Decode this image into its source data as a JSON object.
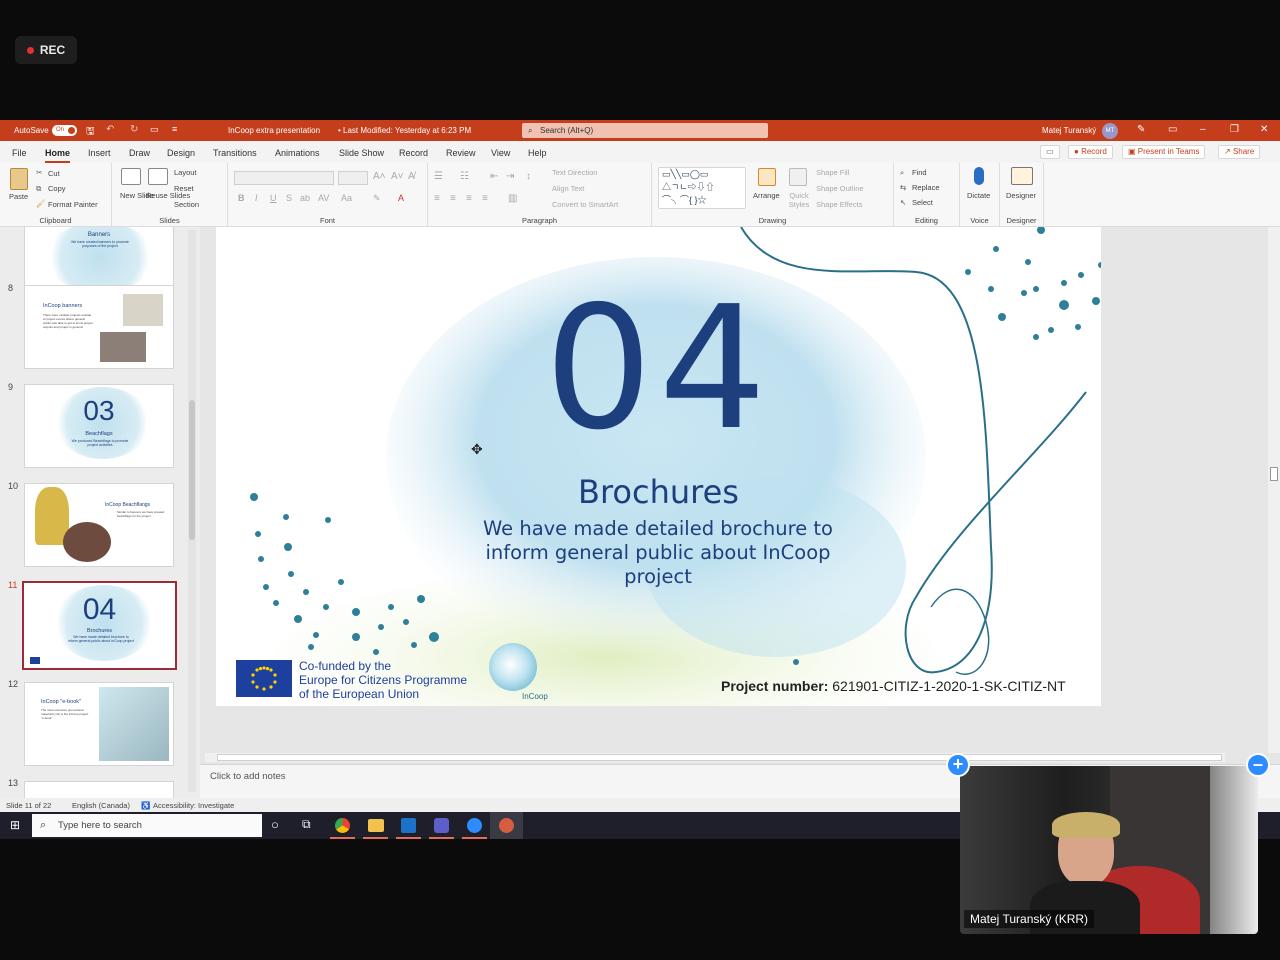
{
  "recording": {
    "label": "REC"
  },
  "titlebar": {
    "autosave_label": "AutoSave",
    "autosave_state": "On",
    "doc_title": "InCoop extra presentation",
    "last_modified": "• Last Modified: Yesterday at 6:23 PM",
    "search_placeholder": "Search (Alt+Q)",
    "user_name": "Matej Turanský",
    "user_initials": "MT"
  },
  "menu": {
    "items": [
      "File",
      "Home",
      "Insert",
      "Draw",
      "Design",
      "Transitions",
      "Animations",
      "Slide Show",
      "Record",
      "Review",
      "View",
      "Help"
    ],
    "active": "Home",
    "record_btn": "Record",
    "present_btn": "Present in Teams",
    "share_btn": "Share"
  },
  "ribbon": {
    "clipboard": {
      "label": "Clipboard",
      "paste": "Paste",
      "cut": "Cut",
      "copy": "Copy",
      "format_painter": "Format Painter"
    },
    "slides": {
      "label": "Slides",
      "new_slide": "New Slide",
      "reuse_slides": "Reuse Slides",
      "layout": "Layout",
      "reset": "Reset",
      "section": "Section"
    },
    "font": {
      "label": "Font"
    },
    "paragraph": {
      "label": "Paragraph",
      "text_direction": "Text Direction",
      "align_text": "Align Text",
      "convert_smartart": "Convert to SmartArt"
    },
    "drawing": {
      "label": "Drawing",
      "arrange": "Arrange",
      "quick_styles": "Quick Styles",
      "shape_fill": "Shape Fill",
      "shape_outline": "Shape Outline",
      "shape_effects": "Shape Effects"
    },
    "editing": {
      "label": "Editing",
      "find": "Find",
      "replace": "Replace",
      "select": "Select"
    },
    "voice": {
      "label": "Voice",
      "dictate": "Dictate"
    },
    "designer": {
      "label": "Designer",
      "designer": "Designer"
    }
  },
  "thumbnails": [
    {
      "num": "",
      "title": "Banners",
      "sub": "We have created banners to promote purposes of the project"
    },
    {
      "num": "8",
      "title": "InCoop banners",
      "sub": "There were multiple projects outside of project events where general public was able to get to know project outputs and project in general."
    },
    {
      "num": "9",
      "big": "03",
      "title": "Beachflags",
      "sub": "We produced Beachflags to promote project activities"
    },
    {
      "num": "10",
      "title": "InCoop Beachflangs",
      "sub": "Similar to banners we have created beachflags for the project"
    },
    {
      "num": "11",
      "big": "04",
      "title": "Brochures",
      "sub": "We have made detailed brochure to inform general public about InCoop project"
    },
    {
      "num": "12",
      "title": "InCoop \"e-book\"",
      "sub": "The most extensive promotional material by far is the InCoop project \"e-book\""
    },
    {
      "num": "13",
      "title": "",
      "sub": ""
    }
  ],
  "slide": {
    "number": "04",
    "title": "Brochures",
    "body_line1": "We have made detailed brochure to",
    "body_line2": "inform general public about InCoop",
    "body_line3": "project",
    "eu_line1": "Co-funded by the",
    "eu_line2": "Europe for Citizens Programme",
    "eu_line3": "of the European Union",
    "logo_text": "InCoop",
    "project_number_label": "Project number:",
    "project_number": "621901-CITIZ-1-2020-1-SK-CITIZ-NT"
  },
  "notes_placeholder": "Click to add notes",
  "status": {
    "slide_info": "Slide 11 of 22",
    "language": "English (Canada)",
    "accessibility": "Accessibility: Investigate"
  },
  "taskbar": {
    "search_placeholder": "Type here to search"
  },
  "video": {
    "participant": "Matej Turanský (KRR)"
  },
  "colors": {
    "accent": "#c43e1c",
    "slide_blue": "#1d3f7d",
    "teal": "#2a6f8a"
  }
}
